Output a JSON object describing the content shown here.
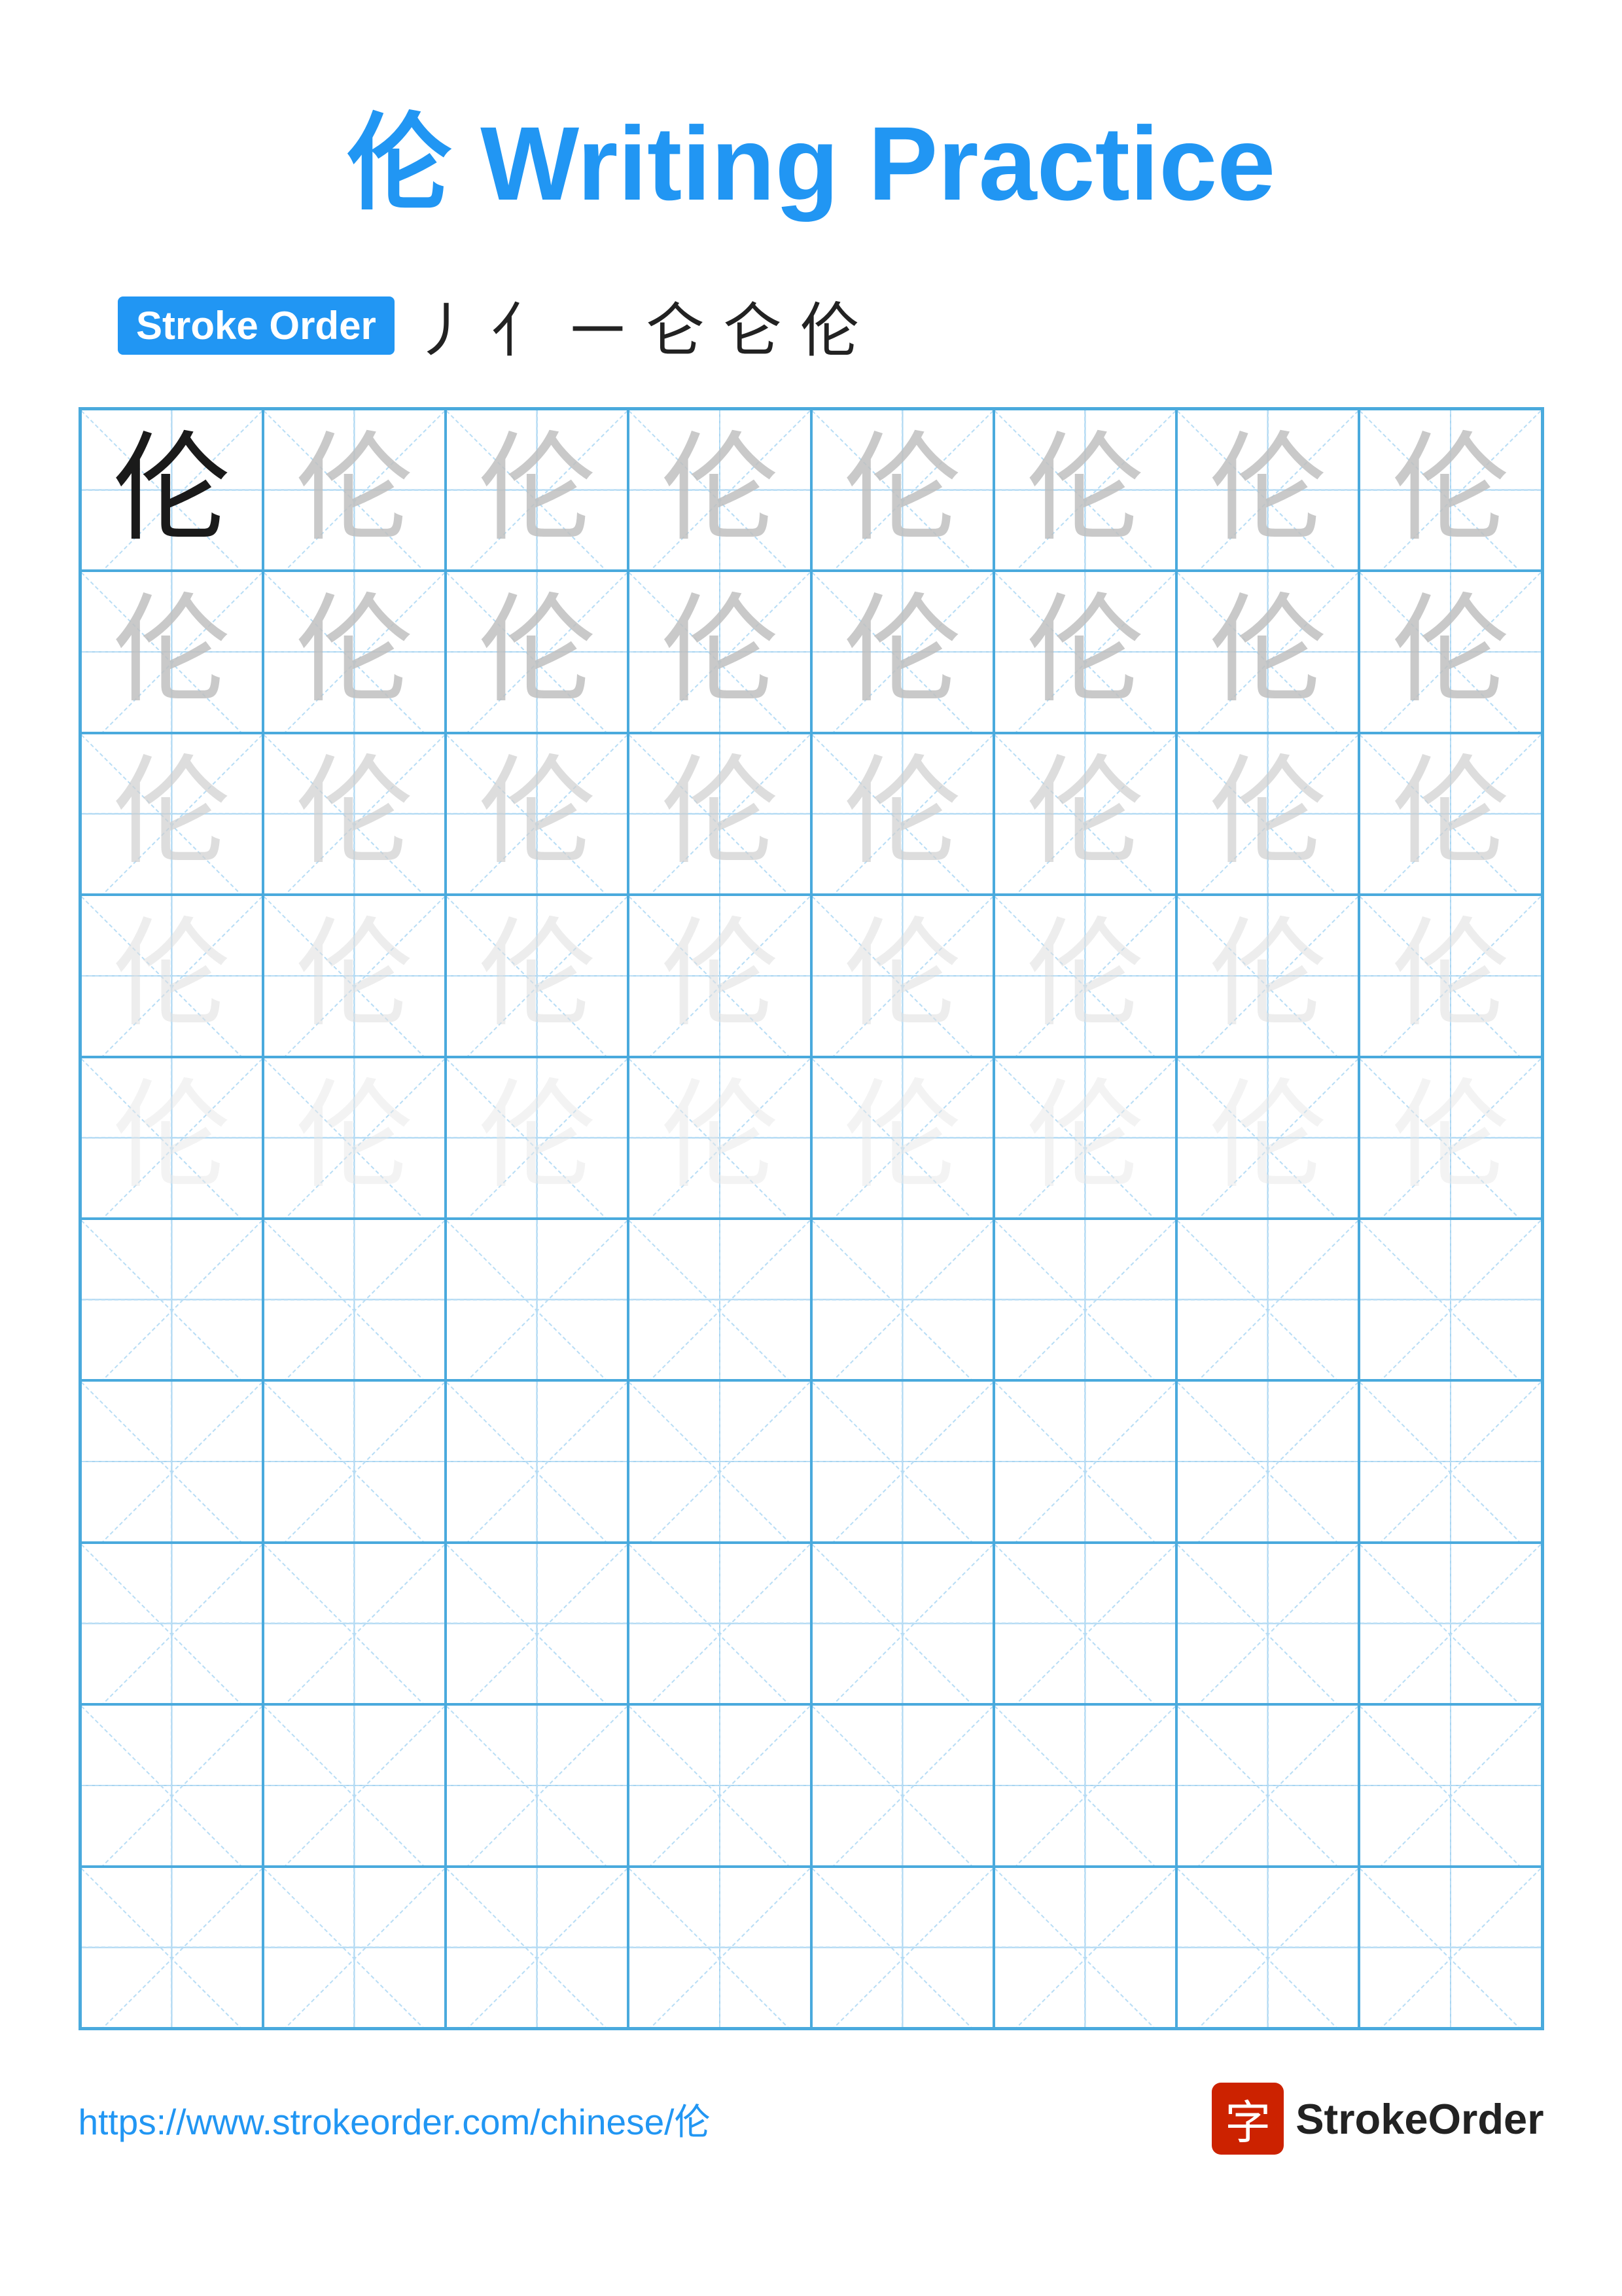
{
  "page": {
    "title": "伦 Writing Practice",
    "stroke_order_label": "Stroke Order",
    "stroke_sequence": [
      "丿",
      "亻",
      "㇀",
      "仑",
      "仑",
      "伦"
    ],
    "character": "伦",
    "url": "https://www.strokeorder.com/chinese/伦",
    "logo_char": "字",
    "logo_text": "StrokeOrder",
    "grid": {
      "cols": 8,
      "rows": 10,
      "practice_rows": 5,
      "empty_rows": 5
    }
  }
}
